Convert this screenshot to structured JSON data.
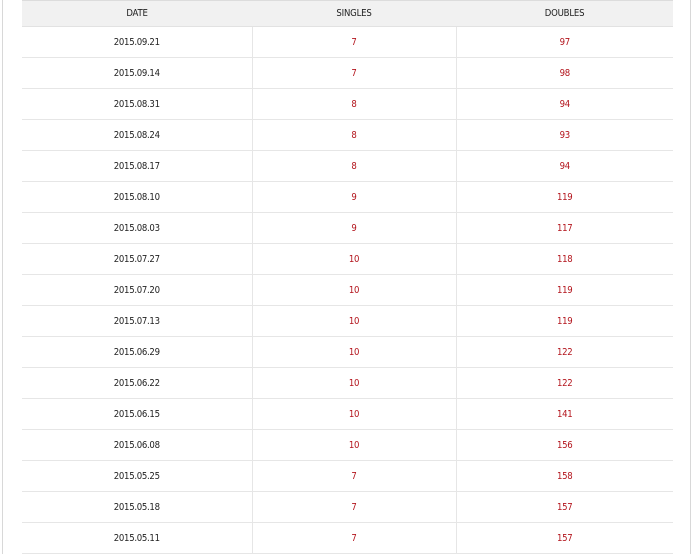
{
  "table": {
    "headers": {
      "date": "DATE",
      "singles": "SINGLES",
      "doubles": "DOUBLES"
    },
    "rows": [
      {
        "date": "2015.09.21",
        "singles": "7",
        "doubles": "97"
      },
      {
        "date": "2015.09.14",
        "singles": "7",
        "doubles": "98"
      },
      {
        "date": "2015.08.31",
        "singles": "8",
        "doubles": "94"
      },
      {
        "date": "2015.08.24",
        "singles": "8",
        "doubles": "93"
      },
      {
        "date": "2015.08.17",
        "singles": "8",
        "doubles": "94"
      },
      {
        "date": "2015.08.10",
        "singles": "9",
        "doubles": "119"
      },
      {
        "date": "2015.08.03",
        "singles": "9",
        "doubles": "117"
      },
      {
        "date": "2015.07.27",
        "singles": "10",
        "doubles": "118"
      },
      {
        "date": "2015.07.20",
        "singles": "10",
        "doubles": "119"
      },
      {
        "date": "2015.07.13",
        "singles": "10",
        "doubles": "119"
      },
      {
        "date": "2015.06.29",
        "singles": "10",
        "doubles": "122"
      },
      {
        "date": "2015.06.22",
        "singles": "10",
        "doubles": "122"
      },
      {
        "date": "2015.06.15",
        "singles": "10",
        "doubles": "141"
      },
      {
        "date": "2015.06.08",
        "singles": "10",
        "doubles": "156"
      },
      {
        "date": "2015.05.25",
        "singles": "7",
        "doubles": "158"
      },
      {
        "date": "2015.05.18",
        "singles": "7",
        "doubles": "157"
      },
      {
        "date": "2015.05.11",
        "singles": "7",
        "doubles": "157"
      }
    ]
  },
  "colors": {
    "header_background": "#f1f1f1",
    "ranking_value": "#b3141c",
    "date_text": "#222222",
    "grid_line": "#e6e6e6"
  }
}
